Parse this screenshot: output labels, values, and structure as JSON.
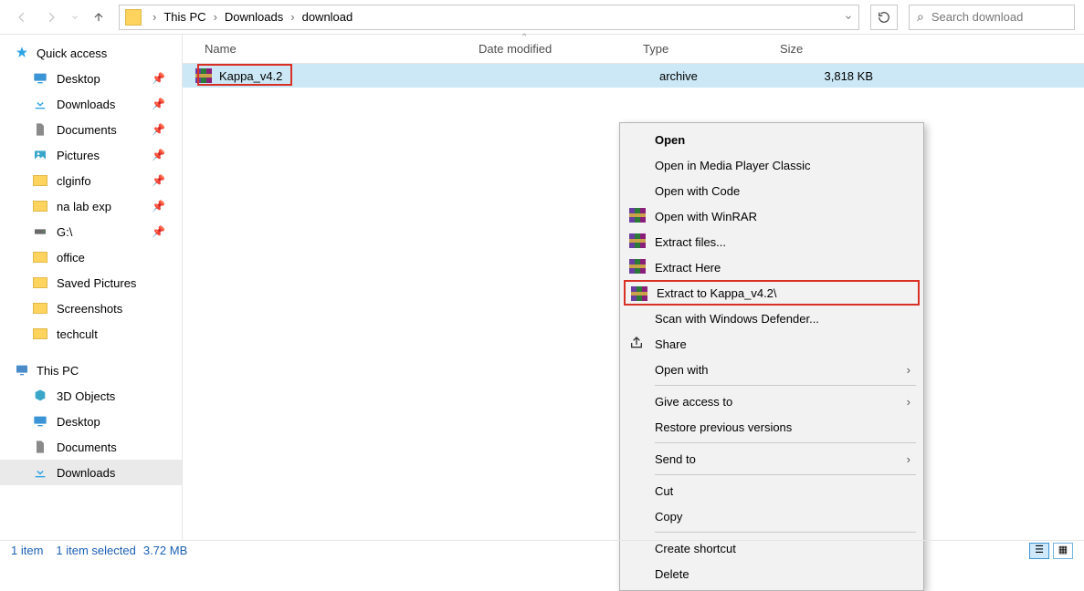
{
  "breadcrumb": {
    "root": "This PC",
    "p1": "Downloads",
    "p2": "download"
  },
  "search": {
    "placeholder": "Search download"
  },
  "columns": {
    "name": "Name",
    "date": "Date modified",
    "type": "Type",
    "size": "Size"
  },
  "file": {
    "name": "Kappa_v4.2",
    "type_visible": "archive",
    "size": "3,818 KB"
  },
  "sidepanel": {
    "quick": "Quick access",
    "items": [
      {
        "label": "Desktop"
      },
      {
        "label": "Downloads"
      },
      {
        "label": "Documents"
      },
      {
        "label": "Pictures"
      },
      {
        "label": "clginfo"
      },
      {
        "label": "na lab exp"
      },
      {
        "label": "G:\\"
      },
      {
        "label": "office"
      },
      {
        "label": "Saved Pictures"
      },
      {
        "label": "Screenshots"
      },
      {
        "label": "techcult"
      }
    ],
    "thispc": "This PC",
    "pcitems": [
      {
        "label": "3D Objects"
      },
      {
        "label": "Desktop"
      },
      {
        "label": "Documents"
      },
      {
        "label": "Downloads"
      }
    ]
  },
  "ctx": {
    "open": "Open",
    "mpc": "Open in Media Player Classic",
    "code": "Open with Code",
    "openrar": "Open with WinRAR",
    "extractfiles": "Extract files...",
    "extracthere": "Extract Here",
    "extractto": "Extract to Kappa_v4.2\\",
    "defender": "Scan with Windows Defender...",
    "share": "Share",
    "openwith": "Open with",
    "giveaccess": "Give access to",
    "restore": "Restore previous versions",
    "sendto": "Send to",
    "cut": "Cut",
    "copy": "Copy",
    "shortcut": "Create shortcut",
    "delete": "Delete"
  },
  "status": {
    "items": "1 item",
    "selected": "1 item selected",
    "size": "3.72 MB"
  }
}
